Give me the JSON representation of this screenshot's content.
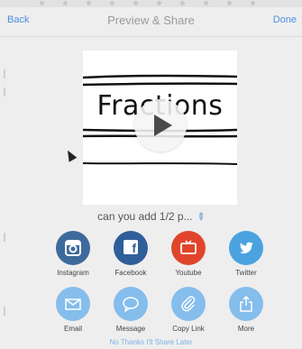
{
  "nav": {
    "back_label": "Back",
    "title": "Preview & Share",
    "done_label": "Done"
  },
  "preview": {
    "thumbnail_text": "Fractions",
    "play_icon": "play-icon",
    "caption": "can you add 1/2 p...",
    "edit_icon": "pencil-icon"
  },
  "share": {
    "row1": [
      {
        "label": "Instagram",
        "icon": "instagram-icon",
        "color": "#3d6a9c"
      },
      {
        "label": "Facebook",
        "icon": "facebook-icon",
        "color": "#2f5f9a"
      },
      {
        "label": "Youtube",
        "icon": "youtube-icon",
        "color": "#e0452b"
      },
      {
        "label": "Twitter",
        "icon": "twitter-icon",
        "color": "#4aa3df"
      }
    ],
    "row2": [
      {
        "label": "Email",
        "icon": "envelope-icon",
        "color": "#85bdec"
      },
      {
        "label": "Message",
        "icon": "speech-bubble-icon",
        "color": "#85bdec"
      },
      {
        "label": "Copy Link",
        "icon": "paperclip-icon",
        "color": "#85bdec"
      },
      {
        "label": "More",
        "icon": "share-icon",
        "color": "#85bdec"
      }
    ]
  },
  "footer": {
    "no_thanks_label": "No Thanks I'll Share Later"
  },
  "colors": {
    "accent": "#4a90e2",
    "background": "#eeeeee"
  }
}
